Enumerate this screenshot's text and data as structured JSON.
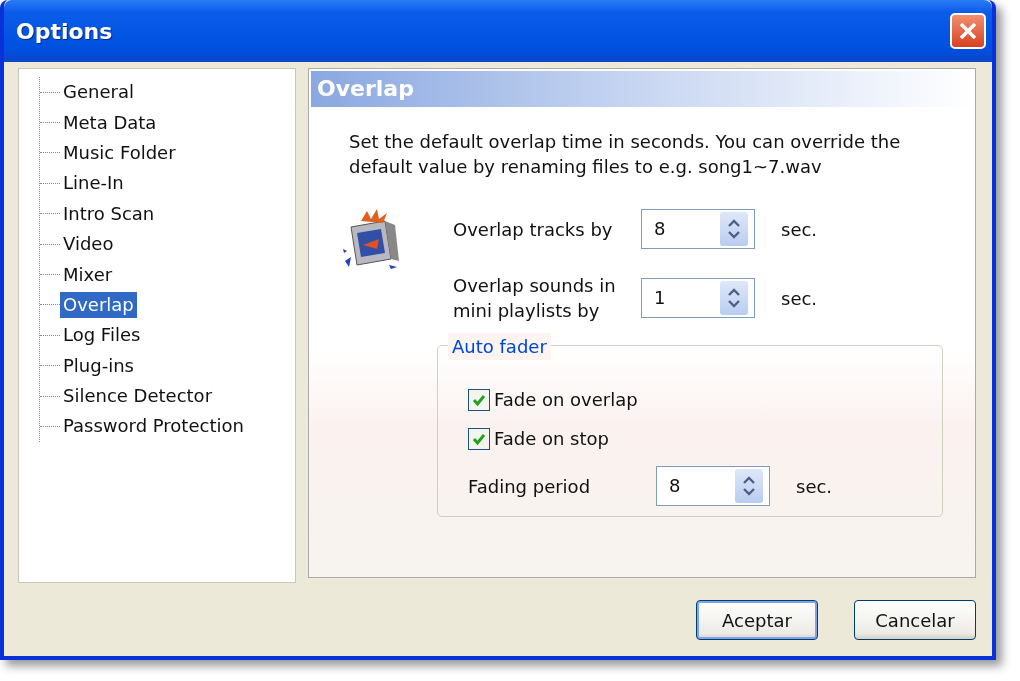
{
  "window": {
    "title": "Options"
  },
  "tree": [
    {
      "label": "General",
      "selected": false
    },
    {
      "label": "Meta Data",
      "selected": false
    },
    {
      "label": "Music Folder",
      "selected": false
    },
    {
      "label": "Line-In",
      "selected": false
    },
    {
      "label": "Intro Scan",
      "selected": false
    },
    {
      "label": "Video",
      "selected": false
    },
    {
      "label": "Mixer",
      "selected": false
    },
    {
      "label": "Overlap",
      "selected": true
    },
    {
      "label": "Log Files",
      "selected": false
    },
    {
      "label": "Plug-ins",
      "selected": false
    },
    {
      "label": "Silence Detector",
      "selected": false
    },
    {
      "label": "Password Protection",
      "selected": false
    }
  ],
  "panel": {
    "title": "Overlap",
    "description": "Set the default overlap time in seconds. You can override the default value by renaming files to e.g. song1~7.wav",
    "fields": [
      {
        "label": "Overlap tracks by",
        "value": "8",
        "unit": "sec."
      },
      {
        "label": "Overlap sounds in mini playlists by",
        "value": "1",
        "unit": "sec."
      }
    ],
    "group": {
      "title": "Auto fader",
      "checkboxes": [
        {
          "label": "Fade on overlap",
          "checked": true
        },
        {
          "label": "Fade on stop",
          "checked": true
        }
      ],
      "field": {
        "label": "Fading period",
        "value": "8",
        "unit": "sec."
      }
    }
  },
  "buttons": [
    {
      "label": "Aceptar",
      "default": true
    },
    {
      "label": "Cancelar",
      "default": false
    }
  ]
}
